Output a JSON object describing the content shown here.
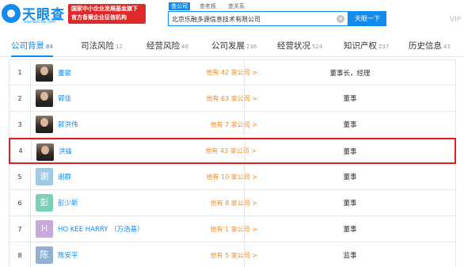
{
  "header": {
    "logo_text": "天眼查",
    "logo_domain": "TianYanCha.com",
    "banner_line1": "国家中小企业发展基金旗下",
    "banner_line2": "官方备案企业征信机构",
    "search_tabs": [
      "查公司",
      "查老板",
      "查关系"
    ],
    "search_value": "北京乐融多源信息技术有限公司",
    "search_button": "天眼一下",
    "vip_label": "VIP",
    "clear_icon": "close-circle-icon"
  },
  "nav": {
    "tabs": [
      {
        "label": "公司背景",
        "count": "84"
      },
      {
        "label": "司法风险",
        "count": "12"
      },
      {
        "label": "经营风险",
        "count": "46"
      },
      {
        "label": "公司发展",
        "count": "236"
      },
      {
        "label": "经营状况",
        "count": "524"
      },
      {
        "label": "知识产权",
        "count": "237"
      },
      {
        "label": "历史信息",
        "count": "43"
      }
    ]
  },
  "members": [
    {
      "num": "1",
      "avatar": "",
      "name": "董骏",
      "companies": "他有 42 家公司 >",
      "role": "董事长，经理"
    },
    {
      "num": "2",
      "avatar": "",
      "name": "郭佳",
      "companies": "他有 63 家公司 >",
      "role": "董事"
    },
    {
      "num": "3",
      "avatar": "",
      "name": "郭洪伟",
      "companies": "他有 7 家公司 >",
      "role": "董事"
    },
    {
      "num": "4",
      "avatar": "",
      "name": "洪锋",
      "companies": "他有 43 家公司 >",
      "role": "董事"
    },
    {
      "num": "5",
      "avatar": "谢",
      "avatar_color": "#9cc9e6",
      "name": "谢群",
      "companies": "他有 10 家公司 >",
      "role": "董事"
    },
    {
      "num": "6",
      "avatar": "彭",
      "avatar_color": "#7ccfb9",
      "name": "彭少新",
      "companies": "他有 8 家公司 >",
      "role": "董事"
    },
    {
      "num": "7",
      "avatar": "H",
      "avatar_color": "#c9a8dc",
      "name": "HO KEE HARRY （万浩基）",
      "companies": "他有 1 家公司 >",
      "role": "董事"
    },
    {
      "num": "8",
      "avatar": "陈",
      "avatar_color": "#94b0d0",
      "name": "陈安平",
      "companies": "他有 5 家公司 >",
      "role": "监事"
    }
  ]
}
